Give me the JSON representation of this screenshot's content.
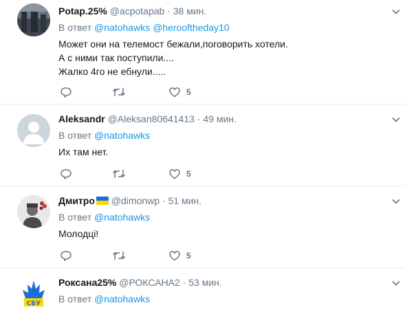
{
  "tweets": [
    {
      "name": "Potap.25%",
      "handle": "@acpotapab",
      "sep": "·",
      "time": "38 мин.",
      "reply_prefix": "В ответ",
      "mentions": [
        "@natohawks",
        "@herooftheday10"
      ],
      "lines": [
        "Может они на телемост бежали,поговорить хотели.",
        "А с ними так поступили....",
        "Жалко 4го не ебнули....."
      ],
      "likes": "5"
    },
    {
      "name": "Aleksandr",
      "handle": "@Aleksan80641413",
      "sep": "·",
      "time": "49 мин.",
      "reply_prefix": "В ответ",
      "mentions": [
        "@natohawks"
      ],
      "lines": [
        "Их там нет."
      ],
      "likes": "5"
    },
    {
      "name": "Дмитро",
      "handle": "@dimonwp",
      "sep": "·",
      "time": "51 мин.",
      "reply_prefix": "В ответ",
      "mentions": [
        "@natohawks"
      ],
      "lines": [
        "Молодці!"
      ],
      "likes": "5"
    },
    {
      "name": "Роксана25%",
      "handle": "@РОКСАНА2",
      "sep": "·",
      "time": "53 мин.",
      "reply_prefix": "В ответ",
      "mentions": [
        "@natohawks"
      ],
      "lines": [],
      "likes": ""
    }
  ],
  "icons": {
    "reply": "reply-icon",
    "retweet": "retweet-icon",
    "like": "heart-icon",
    "menu": "chevron-down-icon"
  },
  "colors": {
    "link": "#1b95e0",
    "muted": "#657786",
    "text": "#14171a",
    "divider": "#e6ecf0"
  }
}
